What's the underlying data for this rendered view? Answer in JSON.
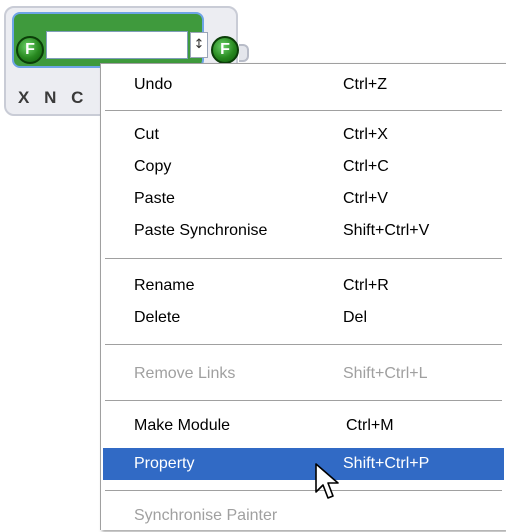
{
  "module": {
    "name_value": "",
    "left_port_letter": "F",
    "right_port_letter": "F",
    "toolbar_letters": [
      "X",
      "N",
      "C"
    ]
  },
  "context_menu": {
    "items": [
      {
        "label": "Undo",
        "shortcut": "Ctrl+Z",
        "disabled": false,
        "selected": false
      },
      {
        "label": "Cut",
        "shortcut": "Ctrl+X",
        "disabled": false,
        "selected": false
      },
      {
        "label": "Copy",
        "shortcut": "Ctrl+C",
        "disabled": false,
        "selected": false
      },
      {
        "label": "Paste",
        "shortcut": "Ctrl+V",
        "disabled": false,
        "selected": false
      },
      {
        "label": "Paste Synchronise",
        "shortcut": "Shift+Ctrl+V",
        "disabled": false,
        "selected": false
      },
      {
        "label": "Rename",
        "shortcut": "Ctrl+R",
        "disabled": false,
        "selected": false
      },
      {
        "label": "Delete",
        "shortcut": "Del",
        "disabled": false,
        "selected": false
      },
      {
        "label": "Remove Links",
        "shortcut": "Shift+Ctrl+L",
        "disabled": true,
        "selected": false
      },
      {
        "label": "Make Module",
        "shortcut": "Ctrl+M",
        "disabled": false,
        "selected": false
      },
      {
        "label": "Property",
        "shortcut": "Shift+Ctrl+P",
        "disabled": false,
        "selected": true
      },
      {
        "label": "Synchronise Painter",
        "shortcut": "",
        "disabled": true,
        "selected": false
      }
    ]
  },
  "colors": {
    "selection": "#316ac5",
    "disabled_text": "#a0a0a0",
    "module_header": "#3f9a3d",
    "module_border_highlight": "#6ea4e6"
  },
  "icons": {
    "port": "port-f-icon",
    "spin": "spin-arrows-icon",
    "cursor": "arrow-cursor-icon"
  }
}
